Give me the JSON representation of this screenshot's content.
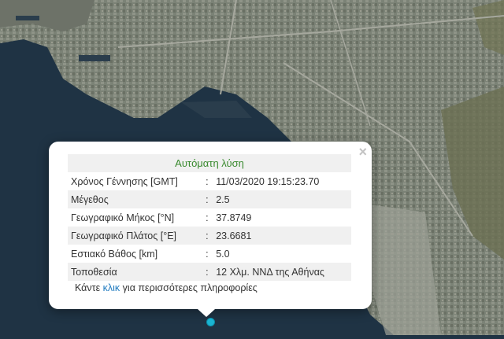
{
  "popup": {
    "close_label": "×",
    "title": "Αυτόματη λύση",
    "rows": [
      {
        "label": "Χρόνος Γέννησης [GMT]",
        "sep": ":",
        "value": "11/03/2020 19:15:23.70"
      },
      {
        "label": "Μέγεθος",
        "sep": ":",
        "value": "2.5"
      },
      {
        "label": "Γεωγραφικό Μήκος [°N]",
        "sep": ":",
        "value": "37.8749"
      },
      {
        "label": "Γεωγραφικό Πλάτος [°E]",
        "sep": ":",
        "value": "23.6681"
      },
      {
        "label": "Εστιακό Βάθος [km]",
        "sep": ":",
        "value": "5.0"
      },
      {
        "label": "Τοποθεσία",
        "sep": ":",
        "value": "12 Χλμ. ΝΝΔ της Αθήνας"
      }
    ],
    "more_prefix": "Κάντε ",
    "more_link": "κλικ",
    "more_suffix": " για περισσότερες πληροφορίες"
  },
  "colors": {
    "sea": "#1f3344",
    "city": "#7d8478",
    "title_green": "#3a8a2f",
    "link_blue": "#1f7abf",
    "marker": "#1ab4d2"
  },
  "icons": {
    "marker": "epicenter-marker-icon",
    "close": "close-icon"
  }
}
